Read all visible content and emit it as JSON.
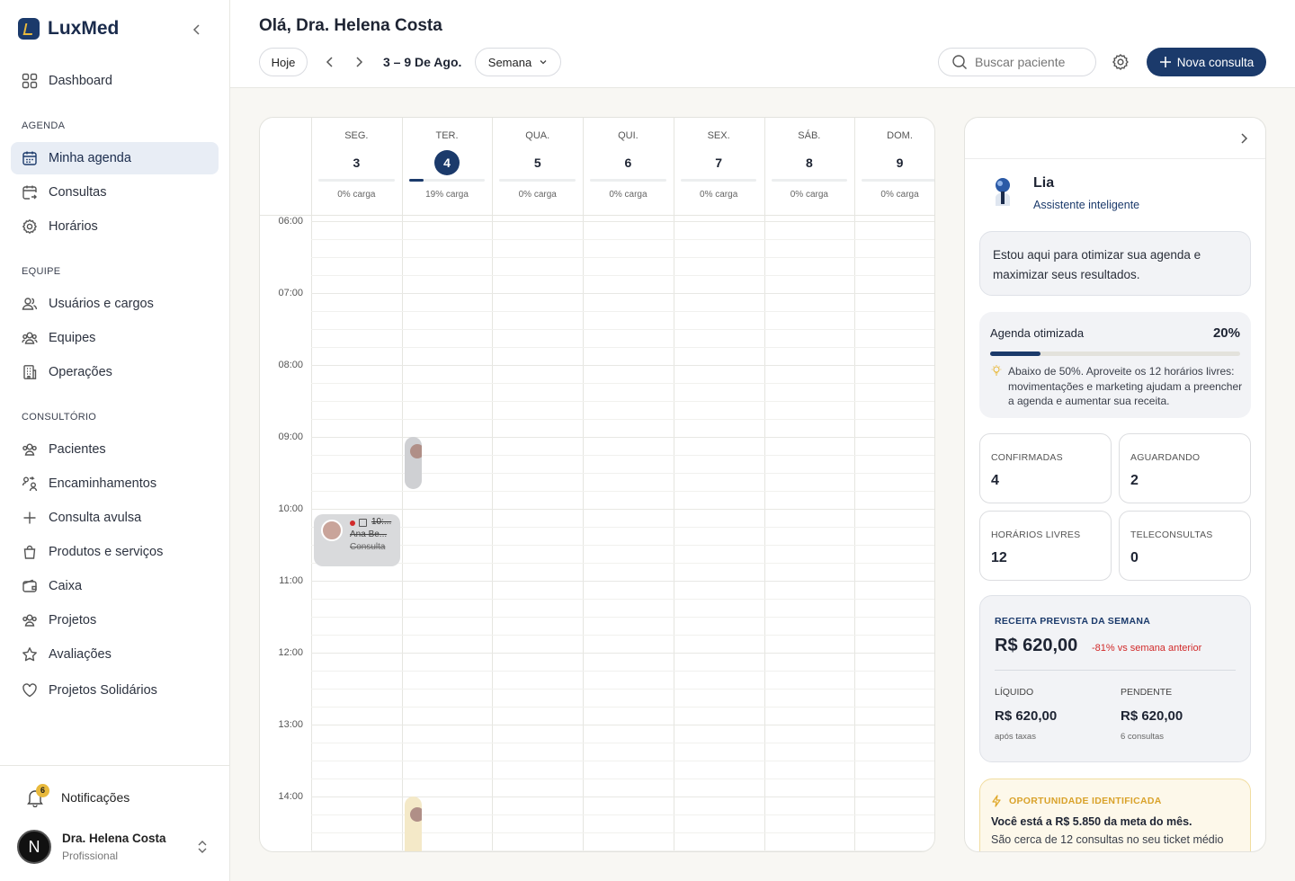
{
  "app": {
    "name": "LuxMed"
  },
  "sidebar": {
    "dashboard": "Dashboard",
    "sections": {
      "agenda": "AGENDA",
      "equipe": "EQUIPE",
      "consultorio": "CONSULTÓRIO"
    },
    "agenda_items": [
      "Minha agenda",
      "Consultas",
      "Horários"
    ],
    "equipe_items": [
      "Usuários e cargos",
      "Equipes",
      "Operações"
    ],
    "consultorio_items": [
      "Pacientes",
      "Encaminhamentos",
      "Consulta avulsa",
      "Produtos e serviços",
      "Caixa",
      "Projetos",
      "Avaliações",
      "Projetos Solidários"
    ],
    "notifications": {
      "label": "Notificações",
      "count": "6"
    },
    "user": {
      "initial": "N",
      "name": "Dra. Helena Costa",
      "role": "Profissional"
    }
  },
  "header": {
    "greeting": "Olá, Dra. Helena Costa",
    "today": "Hoje",
    "range": "3 – 9 De Ago.",
    "view": "Semana",
    "search_placeholder": "Buscar paciente",
    "new_button": "Nova consulta"
  },
  "calendar": {
    "days": [
      {
        "name": "SEG.",
        "num": "3",
        "load": "0% carga",
        "load_pct": 0
      },
      {
        "name": "TER.",
        "num": "4",
        "load": "19% carga",
        "load_pct": 19,
        "today": true
      },
      {
        "name": "QUA.",
        "num": "5",
        "load": "0% carga",
        "load_pct": 0
      },
      {
        "name": "QUI.",
        "num": "6",
        "load": "0% carga",
        "load_pct": 0
      },
      {
        "name": "SEX.",
        "num": "7",
        "load": "0% carga",
        "load_pct": 0
      },
      {
        "name": "SÁB.",
        "num": "8",
        "load": "0% carga",
        "load_pct": 0
      },
      {
        "name": "DOM.",
        "num": "9",
        "load": "0% carga",
        "load_pct": 0
      }
    ],
    "hours": [
      "06:00",
      "07:00",
      "08:00",
      "09:00",
      "10:00",
      "11:00",
      "12:00",
      "13:00",
      "14:00"
    ],
    "event": {
      "time": "10:...",
      "patient": "Ana Be...",
      "type": "Consulta"
    }
  },
  "assistant": {
    "name": "Lia",
    "subtitle": "Assistente inteligente",
    "message": "Estou aqui para otimizar sua agenda e maximizar seus resultados.",
    "optimized_label": "Agenda otimizada",
    "optimized_pct": "20%",
    "optimized_value": 20,
    "tip": "Abaixo de 50%. Aproveite os 12 horários livres: movimentações e marketing ajudam a preencher a agenda e aumentar sua receita.",
    "stats": [
      {
        "label": "CONFIRMADAS",
        "value": "4"
      },
      {
        "label": "AGUARDANDO",
        "value": "2"
      },
      {
        "label": "HORÁRIOS LIVRES",
        "value": "12"
      },
      {
        "label": "TELECONSULTAS",
        "value": "0"
      }
    ],
    "revenue": {
      "title": "RECEITA PREVISTA DA SEMANA",
      "amount": "R$ 620,00",
      "delta": "-81% vs semana anterior",
      "net_label": "LÍQUIDO",
      "net_value": "R$ 620,00",
      "net_note": "após taxas",
      "pending_label": "PENDENTE",
      "pending_value": "R$ 620,00",
      "pending_note": "6 consultas"
    },
    "opportunity": {
      "title": "OPORTUNIDADE IDENTIFICADA",
      "headline": "Você está a R$ 5.850 da meta do mês.",
      "text": "São cerca de 12 consultas no seu ticket médio"
    }
  },
  "colors": {
    "primary": "#1b3a6b",
    "accent": "#e8b93c",
    "danger": "#d12a2a"
  }
}
